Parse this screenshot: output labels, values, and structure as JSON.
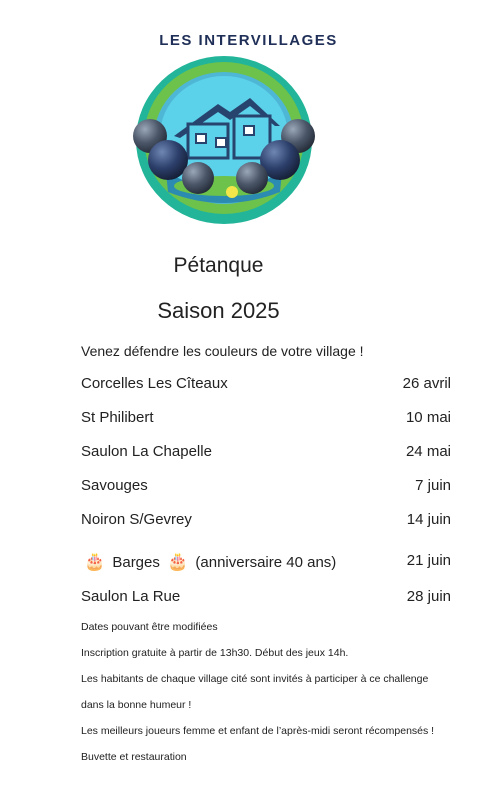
{
  "header": {
    "brand": "LES INTERVILLAGES"
  },
  "heading": {
    "line1": "Pétanque",
    "line2": "Saison 2025"
  },
  "intro": "Venez défendre les couleurs de votre village !",
  "schedule": [
    {
      "place": "Corcelles Les Cîteaux",
      "date": "26 avril"
    },
    {
      "place": "St Philibert",
      "date": "10 mai"
    },
    {
      "place": "Saulon La Chapelle",
      "date": "24 mai"
    },
    {
      "place": "Savouges",
      "date": "7 juin"
    },
    {
      "place": "Noiron S/Gevrey",
      "date": "14 juin"
    },
    {
      "place": "Barges",
      "extra": "(anniversaire 40 ans)",
      "date": "21 juin",
      "icon": "birthday-cake-icon"
    },
    {
      "place": "Saulon La Rue",
      "date": "28 juin"
    }
  ],
  "notes": [
    "Dates pouvant être modifiées",
    "Inscription gratuite à partir de 13h30. Début des jeux 14h.",
    "Les habitants de chaque village cité sont invités à participer à ce challenge",
    "dans la bonne humeur !",
    "Les meilleurs joueurs femme et enfant de l’après-midi seront récompensés !",
    "Buvette et restauration"
  ],
  "colors": {
    "brand": "#1f2f57",
    "ring_outer": "#23b59a",
    "ring_green": "#6cc24a",
    "sky": "#5cd1ea",
    "house": "#27446f"
  }
}
